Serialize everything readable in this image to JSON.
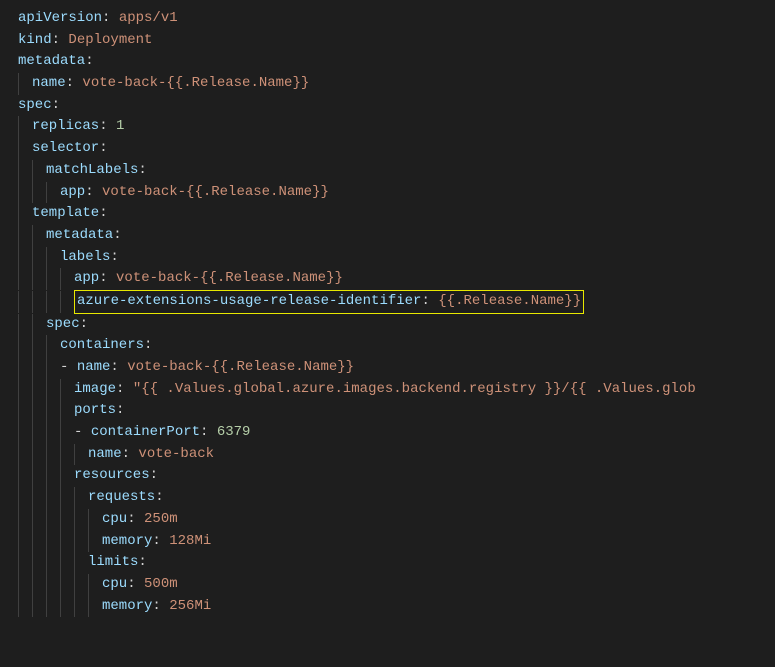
{
  "yaml": {
    "apiVersion": {
      "key": "apiVersion",
      "value": "apps/v1"
    },
    "kind": {
      "key": "kind",
      "value": "Deployment"
    },
    "metadata": {
      "key": "metadata"
    },
    "metadataName": {
      "key": "name",
      "value": "vote-back-{{.Release.Name}}"
    },
    "spec": {
      "key": "spec"
    },
    "replicas": {
      "key": "replicas",
      "value": "1"
    },
    "selector": {
      "key": "selector"
    },
    "matchLabels": {
      "key": "matchLabels"
    },
    "matchLabelsApp": {
      "key": "app",
      "value": "vote-back-{{.Release.Name}}"
    },
    "template": {
      "key": "template"
    },
    "tmplMetadata": {
      "key": "metadata"
    },
    "labels": {
      "key": "labels"
    },
    "labelsApp": {
      "key": "app",
      "value": "vote-back-{{.Release.Name}}"
    },
    "highlighted": {
      "key": "azure-extensions-usage-release-identifier",
      "value": "{{.Release.Name}}"
    },
    "tmplSpec": {
      "key": "spec"
    },
    "containers": {
      "key": "containers"
    },
    "containerName": {
      "key": "name",
      "value": "vote-back-{{.Release.Name}}"
    },
    "image": {
      "key": "image",
      "value": "\"{{ .Values.global.azure.images.backend.registry }}/{{ .Values.glob"
    },
    "ports": {
      "key": "ports"
    },
    "containerPort": {
      "key": "containerPort",
      "value": "6379"
    },
    "portName": {
      "key": "name",
      "value": "vote-back"
    },
    "resources": {
      "key": "resources"
    },
    "requests": {
      "key": "requests"
    },
    "reqCpu": {
      "key": "cpu",
      "value": "250m"
    },
    "reqMemory": {
      "key": "memory",
      "value": "128Mi"
    },
    "limits": {
      "key": "limits"
    },
    "limCpu": {
      "key": "cpu",
      "value": "500m"
    },
    "limMemory": {
      "key": "memory",
      "value": "256Mi"
    }
  }
}
